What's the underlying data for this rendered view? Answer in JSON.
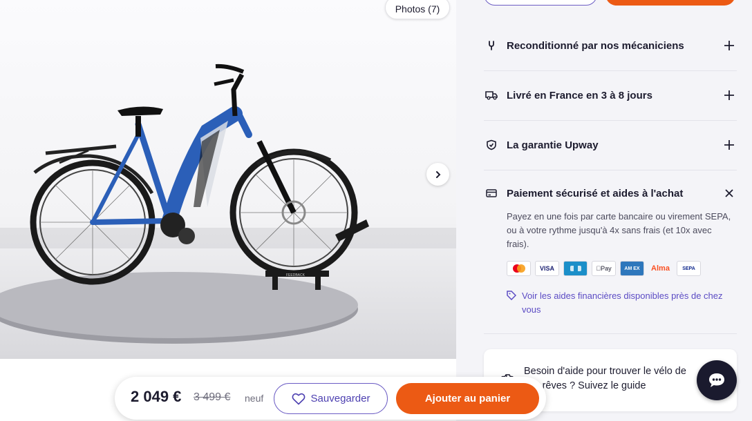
{
  "gallery": {
    "photos_label": "Photos (7)",
    "stand_label": "FEEDBACK"
  },
  "accordion": [
    {
      "title": "Reconditionné par nos mécaniciens",
      "icon": "wrench-icon",
      "state": "collapsed"
    },
    {
      "title": "Livré en France en 3 à 8 jours",
      "icon": "truck-icon",
      "state": "collapsed"
    },
    {
      "title": "La garantie Upway",
      "icon": "shield-icon",
      "state": "collapsed"
    },
    {
      "title": "Paiement sécurisé et aides à l'achat",
      "icon": "credit-card-icon",
      "state": "expanded"
    }
  ],
  "payment": {
    "description": "Payez en une fois par carte bancaire ou virement SEPA, ou à votre rythme jusqu'à 4x sans frais (et 10x avec frais).",
    "methods": [
      {
        "name": "Mastercard",
        "label": ""
      },
      {
        "name": "Visa",
        "label": "VISA"
      },
      {
        "name": "Carte Bancaire",
        "label": ""
      },
      {
        "name": "Apple Pay",
        "label": "Pay"
      },
      {
        "name": "American Express",
        "label": "AM EX"
      },
      {
        "name": "Alma",
        "label": "Alma"
      },
      {
        "name": "SEPA",
        "label": "SEPA"
      }
    ],
    "aid_link": "Voir les aides financières disponibles près de chez vous"
  },
  "help": {
    "text": "Besoin d'aide pour trouver le vélo de vos rêves ? Suivez le guide"
  },
  "sticky_bar": {
    "price": "2 049 €",
    "old_price": "3 499 €",
    "new_label": "neuf",
    "save_label": "Sauvegarder",
    "cart_label": "Ajouter au panier"
  },
  "colors": {
    "accent_orange": "#ec5a14",
    "accent_purple": "#5b4bc4",
    "panel_bg": "#f4f4f8",
    "bike_blue": "#2b5fb8"
  }
}
